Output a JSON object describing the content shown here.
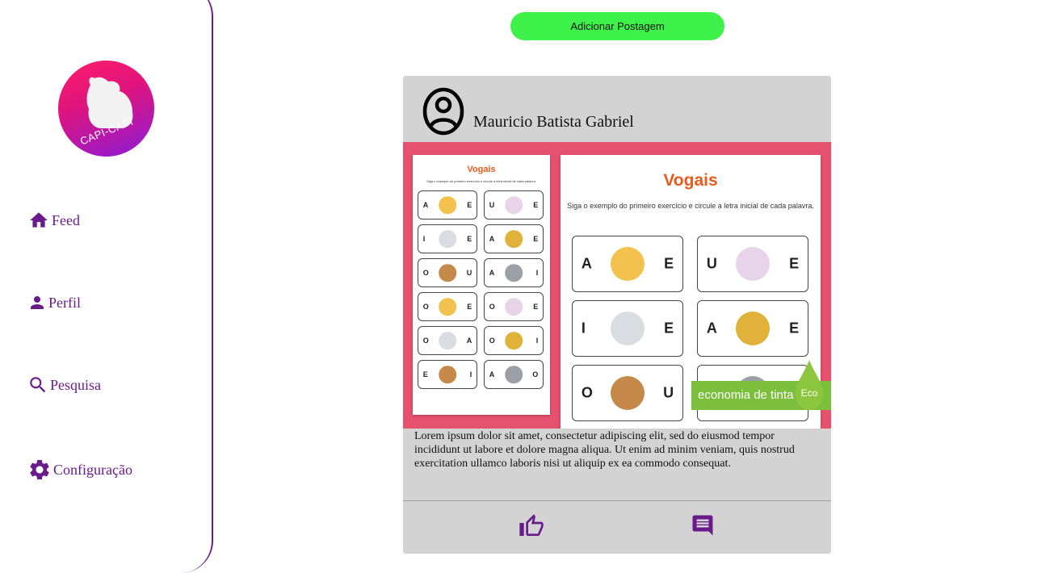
{
  "app": {
    "logo_text": "CAPI-CAPI"
  },
  "colors": {
    "accent": "#6a1b8a",
    "add_button": "#3ff24a",
    "card_bg": "#d3d3d3",
    "image_bg": "#e6516e"
  },
  "sidebar": {
    "items": [
      {
        "label": "Feed",
        "icon": "home-icon"
      },
      {
        "label": "Perfil",
        "icon": "person-icon"
      },
      {
        "label": "Pesquisa",
        "icon": "search-icon"
      },
      {
        "label": "Configuração",
        "icon": "gear-icon"
      }
    ]
  },
  "toolbar": {
    "add_post_label": "Adicionar Postagem"
  },
  "post": {
    "author": "Mauricio Batista Gabriel",
    "image": {
      "title": "Vogais",
      "subtitle": "Siga o exemplo do primeiro exercício e circule a letra inicial de cada palavra.",
      "eco_label": "economia de tinta",
      "eco_badge": "Eco",
      "rows": [
        [
          "A",
          "E"
        ],
        [
          "U",
          "E"
        ],
        [
          "I",
          "E"
        ],
        [
          "A",
          "E"
        ],
        [
          "O",
          "U"
        ],
        [
          "A",
          "I"
        ],
        [
          "O",
          "E"
        ],
        [
          "O",
          "E"
        ],
        [
          "O",
          "A"
        ],
        [
          "O",
          "I"
        ],
        [
          "E",
          "I"
        ],
        [
          "A",
          "O"
        ]
      ]
    },
    "caption": "Lorem ipsum dolor sit amet, consectetur adipiscing elit, sed do eiusmod tempor incididunt ut labore et dolore magna aliqua. Ut enim ad minim veniam, quis nostrud exercitation ullamco laboris nisi ut aliquip ex ea commodo consequat.",
    "actions": {
      "like_icon": "thumb-up-icon",
      "comment_icon": "comment-icon"
    }
  }
}
